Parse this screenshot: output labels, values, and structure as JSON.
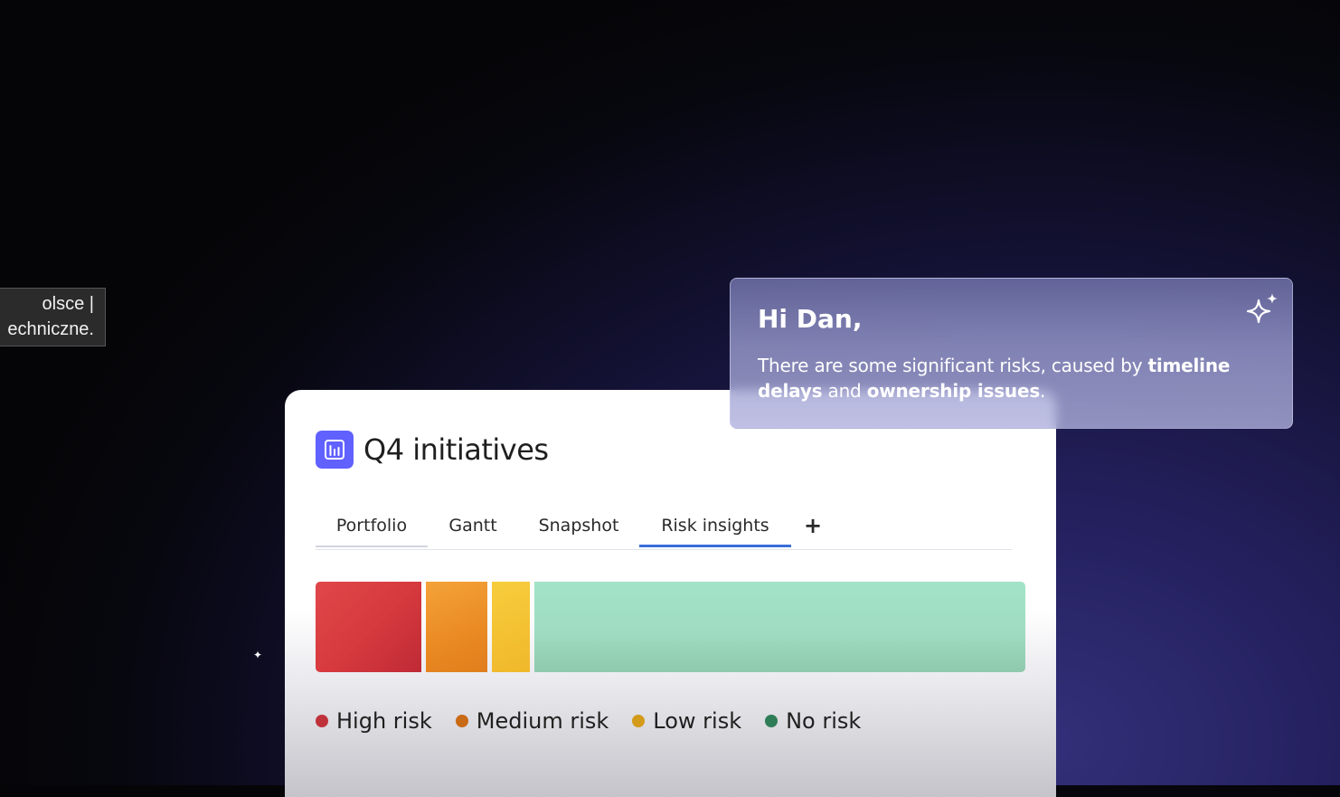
{
  "tooltip": {
    "line1": "olsce |",
    "line2": "echniczne."
  },
  "board": {
    "title": "Q4 initiatives",
    "icon": "bar-chart-icon",
    "tabs": [
      {
        "label": "Portfolio"
      },
      {
        "label": "Gantt"
      },
      {
        "label": "Snapshot"
      },
      {
        "label": "Risk insights",
        "active": true
      },
      {
        "label": "+"
      }
    ]
  },
  "risk_breakdown": {
    "segments": [
      {
        "name": "High risk",
        "fraction": 0.152,
        "color": "#d73a3e"
      },
      {
        "name": "Medium risk",
        "fraction": 0.088,
        "color": "#ea8a23"
      },
      {
        "name": "Low risk",
        "fraction": 0.055,
        "color": "#f0b82b"
      },
      {
        "name": "No risk",
        "fraction": 0.705,
        "color": "#9fdcc1"
      }
    ]
  },
  "legend": [
    {
      "label": "High risk",
      "color": "#c0323b"
    },
    {
      "label": "Medium risk",
      "color": "#c96a16"
    },
    {
      "label": "Low risk",
      "color": "#d49a1a"
    },
    {
      "label": "No risk",
      "color": "#2f7d57"
    }
  ],
  "assistant": {
    "greeting": "Hi Dan,",
    "text_start": "There are some significant risks, caused by ",
    "bold_1": "timeline delays",
    "text_middle": " and ",
    "bold_2": "ownership issues",
    "text_end": ".",
    "icon": "sparkle-icon"
  },
  "colors": {
    "accent": "#6161ff",
    "active_tab": "#3a6fd9"
  }
}
